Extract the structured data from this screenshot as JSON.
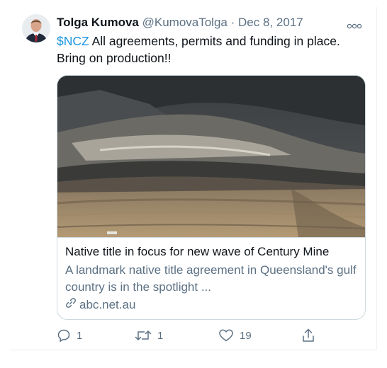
{
  "tweet": {
    "author_name": "Tolga Kumova",
    "handle": "@KumovaTolga",
    "separator": "·",
    "date": "Dec 8, 2017",
    "cashtag": "$NCZ",
    "text": " All agreements, permits and funding in place. Bring on production!!",
    "more_icon": "more-dots-icon"
  },
  "card": {
    "title": "Native title in focus for new wave of Century Mine",
    "description": "A landmark native title agreement in Queensland's gulf country is in the spotlight ...",
    "domain": "abc.net.au",
    "link_icon": "link-icon"
  },
  "actions": {
    "reply_count": "1",
    "retweet_count": "1",
    "like_count": "19",
    "share_icon": "share-icon"
  },
  "colors": {
    "cashtag": "#1b95e0",
    "secondary_text": "#5b7083",
    "border": "#cfd9de"
  }
}
